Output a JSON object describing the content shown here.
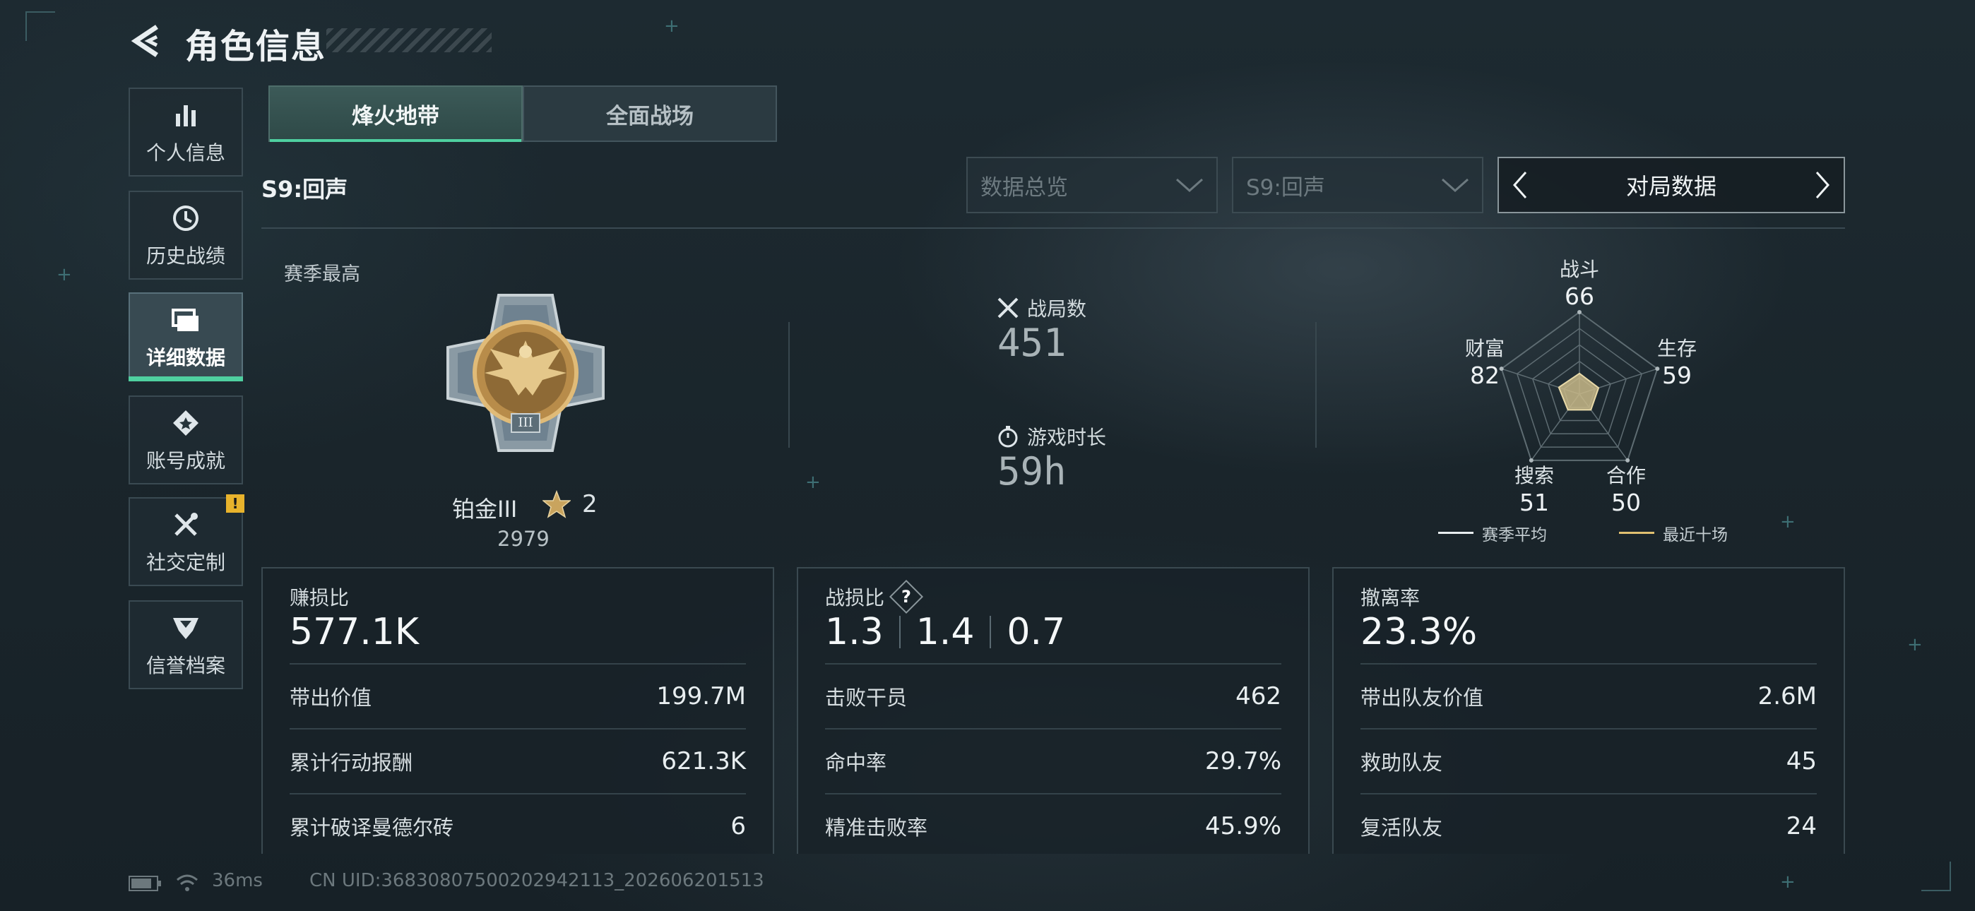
{
  "header": {
    "title": "角色信息"
  },
  "sidebar": {
    "items": [
      {
        "label": "个人信息",
        "icon": "bar-chart-icon"
      },
      {
        "label": "历史战绩",
        "icon": "history-clock-icon"
      },
      {
        "label": "详细数据",
        "icon": "folder-icon"
      },
      {
        "label": "账号成就",
        "icon": "achievement-medal-icon"
      },
      {
        "label": "社交定制",
        "icon": "tools-icon",
        "badge": "!"
      },
      {
        "label": "信誉档案",
        "icon": "credit-shield-icon"
      }
    ],
    "active_index": 2
  },
  "tabs": [
    {
      "label": "烽火地带",
      "active": true
    },
    {
      "label": "全面战场",
      "active": false
    }
  ],
  "filters": {
    "season_label": "S9:回声",
    "overview_dropdown": "数据总览",
    "season_dropdown": "S9:回声",
    "switcher_label": "对局数据"
  },
  "season_best": {
    "heading": "赛季最高",
    "rank_name": "铂金III",
    "stars": "2",
    "score": "2979",
    "emblem_numeral": "III"
  },
  "match_stats": {
    "matches_label": "战局数",
    "matches_value": "451",
    "time_label": "游戏时长",
    "time_value": "59h"
  },
  "radar": {
    "axes": [
      {
        "label": "战斗",
        "value": 66
      },
      {
        "label": "生存",
        "value": 59
      },
      {
        "label": "合作",
        "value": 50
      },
      {
        "label": "搜索",
        "value": 51
      },
      {
        "label": "财富",
        "value": 82
      }
    ],
    "max": 100,
    "legend": [
      {
        "label": "赛季平均",
        "color": "#e8eef0"
      },
      {
        "label": "最近十场",
        "color": "#e0c070"
      }
    ],
    "fill_color": "#c8b888"
  },
  "cards": [
    {
      "heading": "赚损比",
      "big_value": "577.1K",
      "rows": [
        {
          "label": "带出价值",
          "value": "199.7M"
        },
        {
          "label": "累计行动报酬",
          "value": "621.3K"
        },
        {
          "label": "累计破译曼德尔砖",
          "value": "6"
        }
      ]
    },
    {
      "heading": "战损比",
      "help": "?",
      "ratios": [
        "1.3",
        "1.4",
        "0.7"
      ],
      "rows": [
        {
          "label": "击败干员",
          "value": "462"
        },
        {
          "label": "命中率",
          "value": "29.7%"
        },
        {
          "label": "精准击败率",
          "value": "45.9%"
        }
      ]
    },
    {
      "heading": "撤离率",
      "big_value": "23.3%",
      "rows": [
        {
          "label": "带出队友价值",
          "value": "2.6M"
        },
        {
          "label": "救助队友",
          "value": "45"
        },
        {
          "label": "复活队友",
          "value": "24"
        }
      ]
    }
  ],
  "footer": {
    "ping": "36ms",
    "uid": "CN UID:3683080750020294​2113_202606201513"
  },
  "colors": {
    "accent": "#4fd0a0",
    "badge": "#e8b32c"
  }
}
